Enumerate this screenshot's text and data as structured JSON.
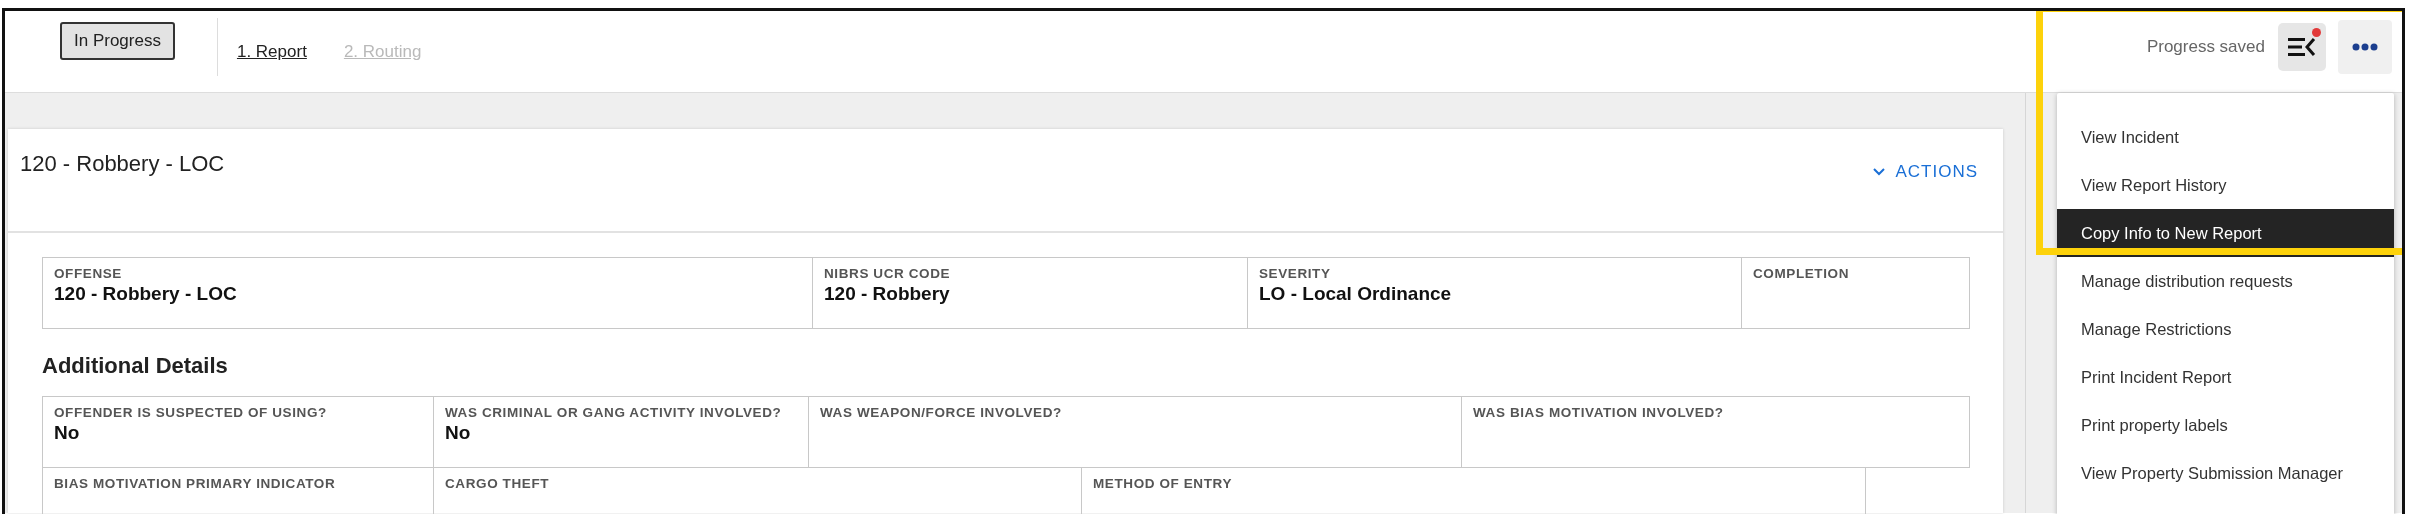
{
  "status_badge": "In Progress",
  "steps": [
    {
      "label": "1. Report",
      "selected": true
    },
    {
      "label": "2. Routing",
      "selected": false
    }
  ],
  "save_status": "Progress saved",
  "panel_toggle": {
    "unread": true
  },
  "card": {
    "title": "120 - Robbery - LOC",
    "actions_label": "ACTIONS",
    "summary_fields": [
      {
        "label": "OFFENSE",
        "value": "120 - Robbery - LOC"
      },
      {
        "label": "NIBRS UCR CODE",
        "value": "120 - Robbery"
      },
      {
        "label": "SEVERITY",
        "value": "LO - Local Ordinance"
      },
      {
        "label": "COMPLETION"
      }
    ],
    "section_title": "Additional Details",
    "detail_rows": [
      [
        {
          "label": "OFFENDER IS SUSPECTED OF USING?",
          "value": "No"
        },
        {
          "label": "WAS CRIMINAL OR GANG ACTIVITY INVOLVED?",
          "value": "No"
        },
        {
          "label": "WAS WEAPON/FORCE INVOLVED?"
        },
        {
          "label": "WAS BIAS MOTIVATION INVOLVED?"
        }
      ],
      [
        {
          "label": "BIAS MOTIVATION PRIMARY INDICATOR"
        },
        {
          "label": "CARGO THEFT"
        },
        {
          "label": "METHOD OF ENTRY"
        }
      ]
    ]
  },
  "menu": {
    "items": [
      {
        "label": "View Incident",
        "selected": false
      },
      {
        "label": "View Report History",
        "selected": false
      },
      {
        "label": "Copy Info to New Report",
        "selected": true
      },
      {
        "label": "Manage distribution requests",
        "selected": false
      },
      {
        "label": "Manage Restrictions",
        "selected": false
      },
      {
        "label": "Print Incident Report",
        "selected": false
      },
      {
        "label": "Print property labels",
        "selected": false
      },
      {
        "label": "View Property Submission Manager",
        "selected": false
      }
    ]
  }
}
